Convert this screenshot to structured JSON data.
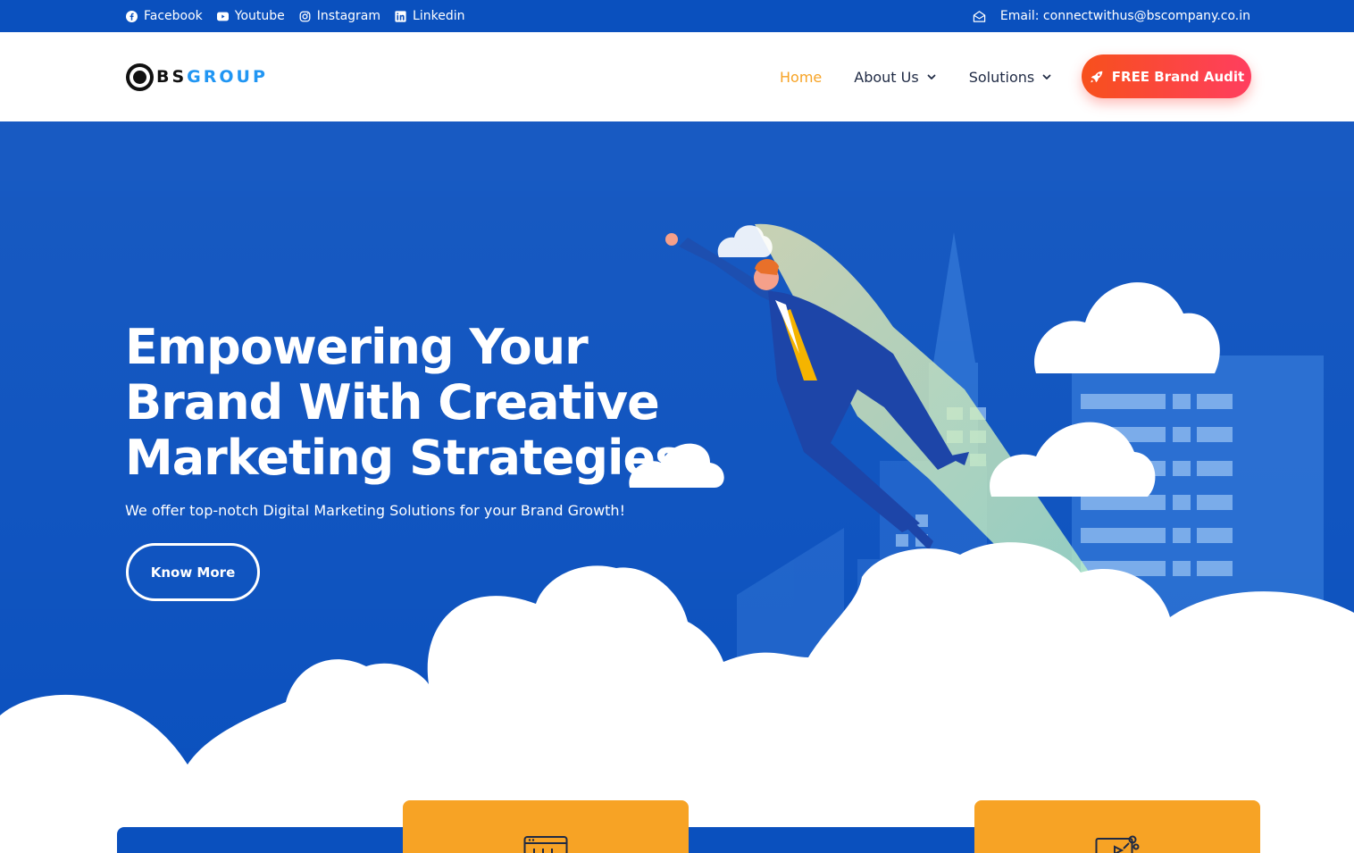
{
  "topbar": {
    "social": [
      {
        "label": "Facebook",
        "icon": "facebook-icon"
      },
      {
        "label": "Youtube",
        "icon": "youtube-icon"
      },
      {
        "label": "Instagram",
        "icon": "instagram-icon"
      },
      {
        "label": "Linkedin",
        "icon": "linkedin-icon"
      }
    ],
    "email": "Email: connectwithus@bscompany.co.in",
    "email_icon": "envelope-open-icon"
  },
  "header": {
    "logo": {
      "part1": "BS",
      "part2": "GROUP"
    },
    "nav": {
      "home": "Home",
      "about": "About Us",
      "solutions": "Solutions"
    },
    "cta_label": "FREE Brand Audit",
    "cta_icon": "rocket-icon"
  },
  "hero": {
    "title_lines": [
      "Empowering Your",
      "Brand With Creative",
      "Marketing Strategies"
    ],
    "subtitle": "We offer top-notch Digital Marketing Solutions for your Brand Growth!",
    "button_label": "Know More"
  },
  "colors": {
    "brand_blue": "#0a50be",
    "accent_orange": "#f7a325",
    "cta_red": "#ff3e5f",
    "logo_blue": "#2196f3"
  },
  "features": {
    "card1_icon": "calendar-icon",
    "card2_icon": "presentation-chart-icon"
  }
}
